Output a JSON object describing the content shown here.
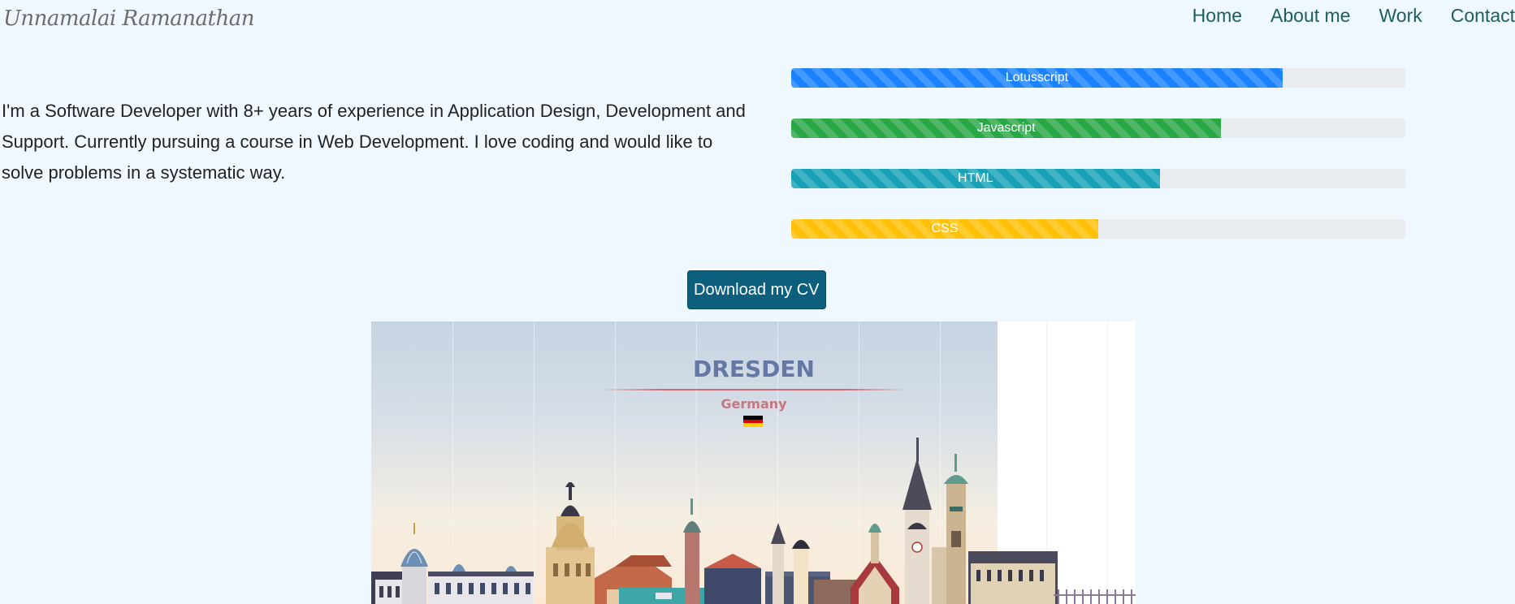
{
  "brand": {
    "name": "Unnamalai Ramanathan"
  },
  "nav": {
    "items": [
      {
        "label": "Home"
      },
      {
        "label": "About me"
      },
      {
        "label": "Work"
      },
      {
        "label": "Contact"
      }
    ]
  },
  "intro": {
    "text": "I'm a Software Developer with 8+ years of experience in Application Design, Development and Support. Currently pursuing a course in Web Development. I love coding and would like to solve problems in a systematic way."
  },
  "skills": [
    {
      "label": "Lotusscript",
      "percent": 80,
      "color": "#1a82ff"
    },
    {
      "label": "Javascript",
      "percent": 70,
      "color": "#28a745"
    },
    {
      "label": "HTML",
      "percent": 60,
      "color": "#17a2b8"
    },
    {
      "label": "CSS",
      "percent": 50,
      "color": "#ffc107"
    }
  ],
  "cv_button": {
    "label": "Download my CV"
  },
  "banner": {
    "city": "DRESDEN",
    "country": "Germany",
    "flag_colors": [
      "#000000",
      "#dd0000",
      "#ffce00"
    ]
  }
}
